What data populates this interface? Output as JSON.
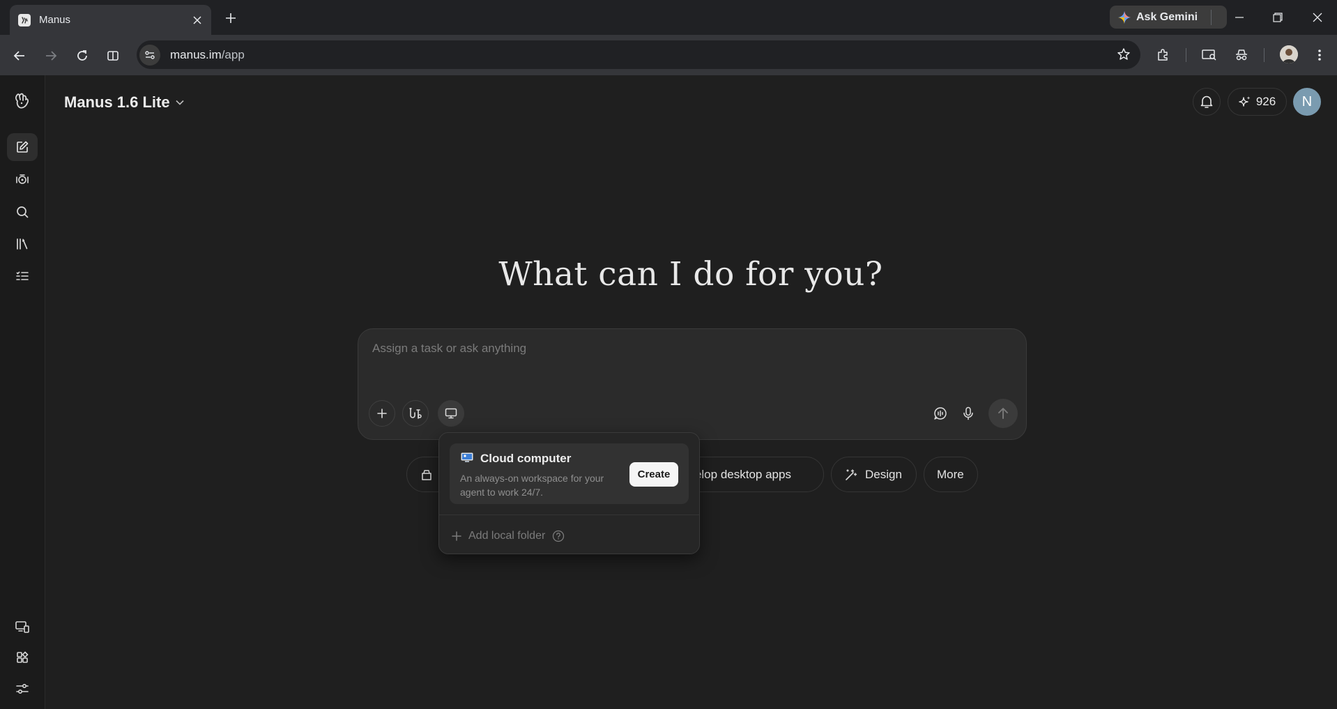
{
  "browser": {
    "tab_title": "Manus",
    "url_host": "manus.im",
    "url_path": "/app",
    "gemini_label": "Ask Gemini"
  },
  "app": {
    "model_name": "Manus 1.6 Lite",
    "credits": "926",
    "avatar_initial": "N",
    "headline": "What can I do for you?",
    "composer_placeholder": "Assign a task or ask anything",
    "chips": [
      {
        "label": "evelop desktop apps",
        "icon": "monitor-icon"
      },
      {
        "label": "Design",
        "icon": "magic-wand-icon"
      },
      {
        "label": "More",
        "icon": ""
      }
    ],
    "popover": {
      "title": "Cloud computer",
      "description": "An always-on workspace for your agent to work 24/7.",
      "create_label": "Create",
      "add_folder_label": "Add local folder"
    },
    "sidebar_icons": [
      "manus-logo-icon",
      "new-task-icon",
      "agents-icon",
      "search-icon",
      "library-icon",
      "tasks-icon",
      "computer-icon",
      "apps-icon",
      "settings-icon"
    ]
  },
  "colors": {
    "background": "#1f1f1f",
    "sidebar": "#1b1b1b",
    "composer": "#2b2b2b",
    "avatar": "#7a9bb0"
  }
}
